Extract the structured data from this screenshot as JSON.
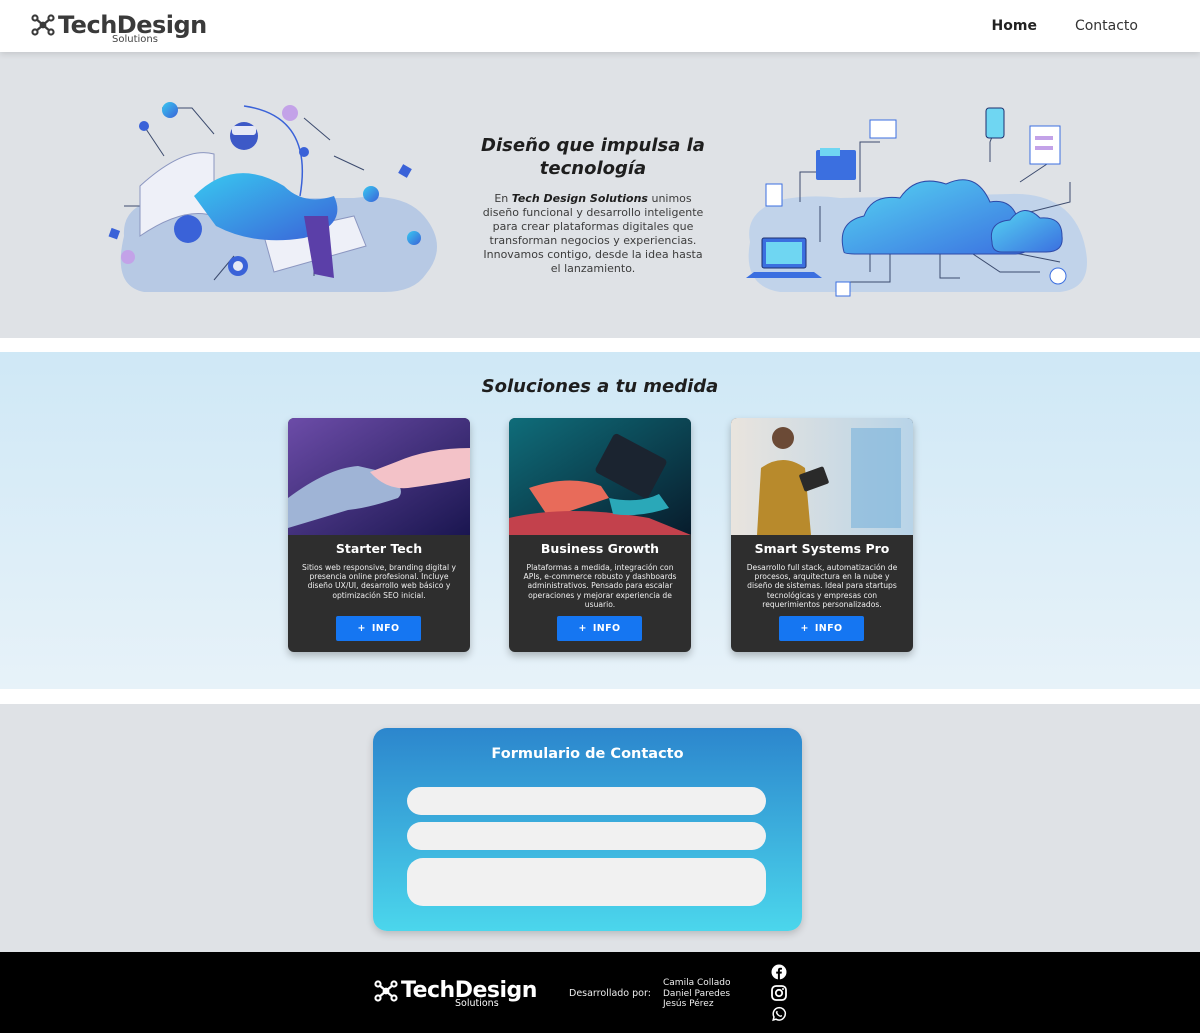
{
  "nav": {
    "logo_text": "TechDesign",
    "logo_sub": "Solutions",
    "links": [
      "Home",
      "Contacto"
    ]
  },
  "hero": {
    "title": "Diseño que impulsa la tecnología",
    "body_prefix": "En",
    "body_brand": "Tech Design Solutions",
    "body_rest": "unimos diseño funcional y desarrollo inteligente para crear plataformas digitales que transforman negocios y experiencias. Innovamos contigo, desde la idea hasta el lanzamiento."
  },
  "solutions": {
    "title": "Soluciones a tu medida",
    "cards": [
      {
        "title": "Starter Tech",
        "desc": "Sitios web responsive, branding digital y presencia online profesional. Incluye diseño UX/UI, desarrollo web básico y optimización SEO inicial.",
        "button": "INFO"
      },
      {
        "title": "Business Growth",
        "desc": "Plataformas a medida, integración con APIs, e-commerce robusto y dashboards administrativos. Pensado para escalar operaciones y mejorar experiencia de usuario.",
        "button": "INFO"
      },
      {
        "title": "Smart Systems Pro",
        "desc": "Desarrollo full stack, automatización de procesos, arquitectura en la nube y diseño de sistemas. Ideal para startups tecnológicas y empresas con requerimientos personalizados.",
        "button": "INFO"
      }
    ],
    "button_icon": "+"
  },
  "contact": {
    "title": "Formulario de Contacto",
    "fields": [
      {
        "placeholder": "",
        "value": ""
      },
      {
        "placeholder": "",
        "value": ""
      },
      {
        "placeholder": "",
        "value": ""
      }
    ]
  },
  "footer": {
    "logo_text": "TechDesign",
    "logo_sub": "Solutions",
    "dev_label": "Desarrollado por:",
    "developers": [
      "Camila Collado",
      "Daniel Paredes",
      "Jesús Pérez"
    ],
    "social_icons": [
      "facebook-icon",
      "instagram-icon",
      "whatsapp-icon"
    ]
  },
  "colors": {
    "accent_button": "#1576f2",
    "form_gradient_top": "#2c86cd",
    "form_gradient_bottom": "#4bd6ec",
    "card_bg": "#2e2e2e",
    "footer_bg": "#000000"
  }
}
